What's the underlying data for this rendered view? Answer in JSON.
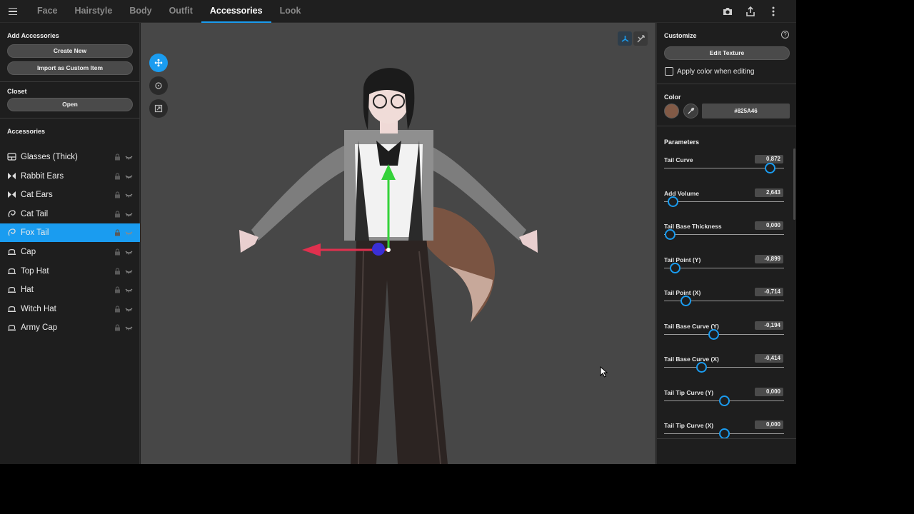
{
  "nav": {
    "tabs": [
      {
        "label": "Face"
      },
      {
        "label": "Hairstyle"
      },
      {
        "label": "Body"
      },
      {
        "label": "Outfit"
      },
      {
        "label": "Accessories",
        "active": true
      },
      {
        "label": "Look"
      }
    ],
    "icons": [
      "menu-icon",
      "camera-icon",
      "share-icon",
      "more-vertical-icon"
    ]
  },
  "left": {
    "add_title": "Add Accessories",
    "create_new": "Create New",
    "import_custom": "Import as Custom Item",
    "closet_title": "Closet",
    "open": "Open",
    "accessories_title": "Accessories",
    "items": [
      {
        "label": "Glasses (Thick)",
        "icon": "glasses-icon"
      },
      {
        "label": "Rabbit Ears",
        "icon": "ears-icon"
      },
      {
        "label": "Cat Ears",
        "icon": "ears-icon"
      },
      {
        "label": "Cat Tail",
        "icon": "tail-icon"
      },
      {
        "label": "Fox Tail",
        "icon": "tail-icon",
        "selected": true
      },
      {
        "label": "Cap",
        "icon": "hat-icon"
      },
      {
        "label": "Top Hat",
        "icon": "hat-icon"
      },
      {
        "label": "Hat",
        "icon": "hat-icon"
      },
      {
        "label": "Witch Hat",
        "icon": "hat-icon"
      },
      {
        "label": "Army Cap",
        "icon": "hat-icon"
      }
    ]
  },
  "right": {
    "customize_title": "Customize",
    "edit_texture": "Edit Texture",
    "apply_color": "Apply color when editing",
    "color_title": "Color",
    "color_hex": "#825A46",
    "parameters_title": "Parameters",
    "params": [
      {
        "label": "Tail Curve",
        "value": "0,872",
        "level": 0.88
      },
      {
        "label": "Add Volume",
        "value": "2,643",
        "level": 0.07
      },
      {
        "label": "Tail Base Thickness",
        "value": "0,000",
        "level": 0.05
      },
      {
        "label": "Tail Point (Y)",
        "value": "-0,899",
        "level": 0.09
      },
      {
        "label": "Tail Point (X)",
        "value": "-0,714",
        "level": 0.18
      },
      {
        "label": "Tail Base Curve (Y)",
        "value": "-0,194",
        "level": 0.41
      },
      {
        "label": "Tail Base Curve (X)",
        "value": "-0,414",
        "level": 0.31
      },
      {
        "label": "Tail Tip Curve (Y)",
        "value": "0,000",
        "level": 0.5
      },
      {
        "label": "Tail Tip Curve (X)",
        "value": "0,000",
        "level": 0.5
      }
    ]
  },
  "colors": {
    "accent": "#1a9cf0",
    "swatch": "#825A46"
  }
}
